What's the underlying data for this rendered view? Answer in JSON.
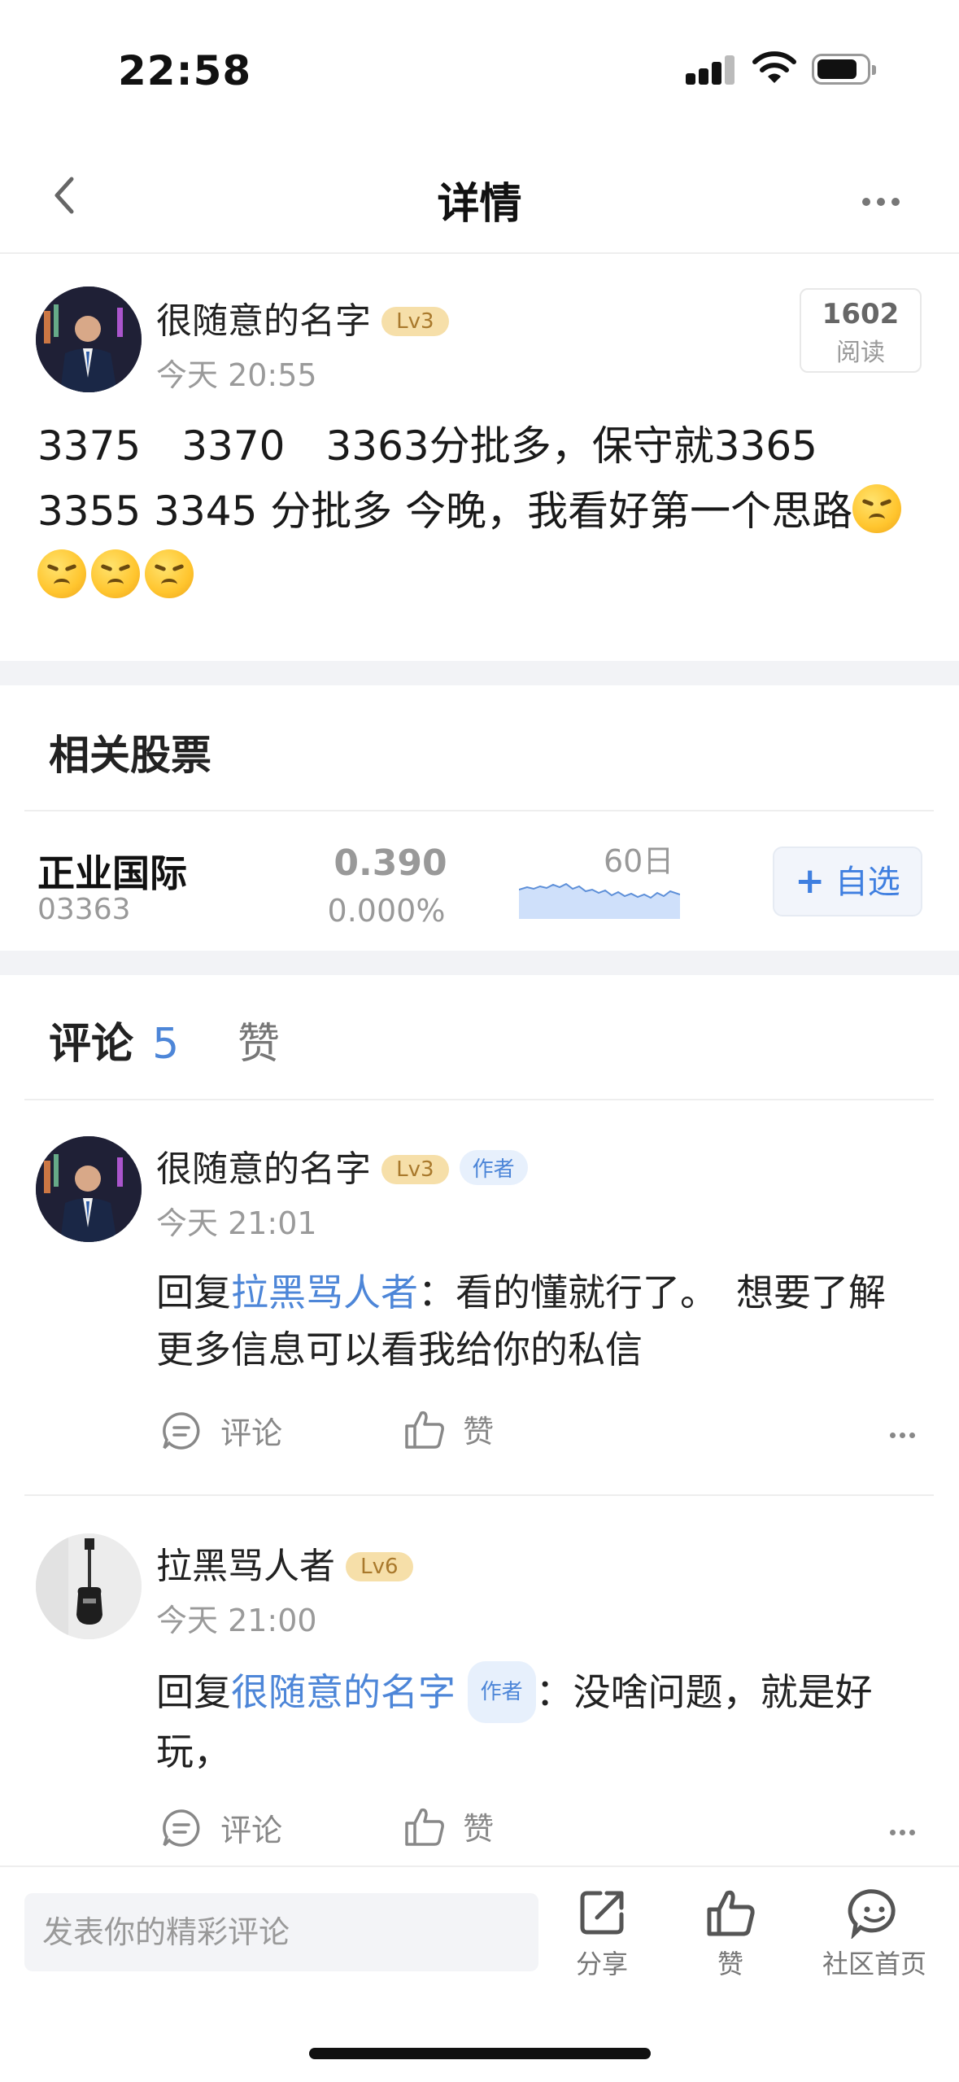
{
  "status_bar": {
    "time": "22:58"
  },
  "nav": {
    "title": "详情"
  },
  "post": {
    "author": "很随意的名字",
    "level": "Lv3",
    "time": "今天 20:55",
    "reads": "1602",
    "reads_label": "阅读",
    "text": "3375　3370　3363分批多，保守就3365　3355  3345  分批多 今晚，我看好第一个思路"
  },
  "related": {
    "title": "相关股票",
    "stock": {
      "name": "正业国际",
      "code": "03363",
      "price": "0.390",
      "change": "0.000%",
      "period": "60日",
      "add_label": "自选"
    }
  },
  "tabs": {
    "comments_label": "评论",
    "comments_count": "5",
    "likes_label": "赞"
  },
  "comments": [
    {
      "author": "很随意的名字",
      "level": "Lv3",
      "author_tag": "作者",
      "time": "今天 21:01",
      "reply_prefix": "回复",
      "reply_to": "拉黑骂人者",
      "text": "：看的懂就行了。　想要了解更多信息可以看我给你的私信",
      "comment_label": "评论",
      "like_label": "赞"
    },
    {
      "author": "拉黑骂人者",
      "level": "Lv6",
      "time": "今天 21:00",
      "reply_prefix": "回复",
      "reply_to": "很随意的名字",
      "reply_to_tag": "作者",
      "text": "：没啥问题，就是好玩，",
      "comment_label": "评论",
      "like_label": "赞"
    }
  ],
  "bottom_bar": {
    "input_placeholder": "发表你的精彩评论",
    "share": "分享",
    "like": "赞",
    "community": "社区首页"
  },
  "colors": {
    "accent": "#4d86d8",
    "level_bg": "#f6dfa9",
    "chart_fill": "#cfe0fa",
    "chart_line": "#5d8fd8"
  }
}
